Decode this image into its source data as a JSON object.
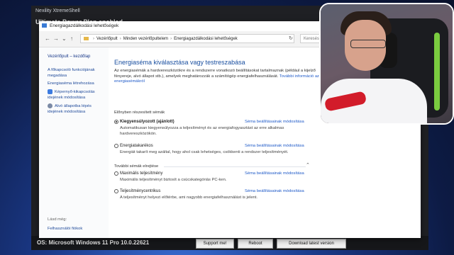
{
  "bg_window": {
    "title": "Nexility XtremeShell",
    "heading": "Ultimate Power Plan enabled",
    "os_text": "OS: Microsoft Windows 11 Pro 10.0.22621",
    "buttons": [
      "Support me!",
      "Reboot",
      "Download latest version"
    ]
  },
  "cp_window": {
    "title": "Energiagazdálkodási lehetőségek",
    "nav": {
      "back": "←",
      "forward": "→",
      "down": "⌄",
      "up": "↑"
    },
    "address": [
      "Vezérlőpult",
      "Minden vezérlőpultelem",
      "Energiagazdálkodási lehetőségek"
    ],
    "search_placeholder": "Keresés",
    "refresh": "↻"
  },
  "left_pane": {
    "home": "Vezérlőpult – kezdőlap",
    "links": [
      "A főkapcsoló funkciójának megadása",
      "Energiaséma létrehozása",
      "Képernyő-kikapcsolás idejének módosítása",
      "Alvó állapotba lépés idejének módosítása"
    ],
    "see_also": "Lásd még:",
    "user_accounts": "Felhasználói fiókok"
  },
  "main": {
    "heading": "Energiaséma kiválasztása vagy testreszabása",
    "intro": "Az energiasémák a hardvereszközökre és a rendszerre vonatkozó beállításokat tartalmaznak (például a kijelző fényereje, alvó állapot stb.), amelyek meghatározzák a számítógép energiafelhasználását.",
    "intro_link": "További információ az energiasémákról",
    "preferred_label": "Előnyben részesített sémák",
    "more_label": "További sémák elrejtése",
    "change_link": "Séma beállításainak módosítása",
    "plans": [
      {
        "name": "Kiegyensúlyozott (ajánlott)",
        "desc": "Automatikusan kiegyensúlyozza a teljesítményt és az energiafogyasztást az erre alkalmas hardvereszközökön.",
        "selected": true
      },
      {
        "name": "Energiatakarékos",
        "desc": "Energiát takarít meg azáltal, hogy ahol csak lehetséges, csökkenti a rendszer teljesítményét.",
        "selected": false
      },
      {
        "name": "Maximális teljesítmény",
        "desc": "Maximális teljesítményt biztosít a csúcskategóriás PC-ken.",
        "selected": false
      },
      {
        "name": "Teljesítménycentrikus",
        "desc": "A teljesítményt helyezi előtérbe, ami nagyobb energiafelhasználást is jelent.",
        "selected": false
      }
    ]
  },
  "colors": {
    "accent": "#1a4fa0",
    "link": "#1f5ac8",
    "desktop": "#1b3a8a"
  },
  "icons": {
    "window-icon": "power-options",
    "address-icon": "folder",
    "shield-1": "shield",
    "shield-2": "moon"
  }
}
